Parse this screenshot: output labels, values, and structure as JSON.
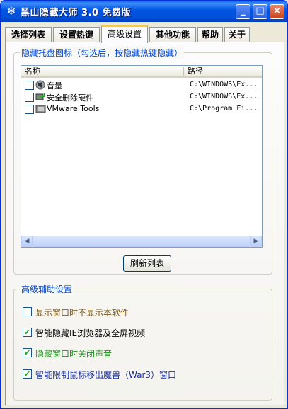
{
  "window": {
    "title": "黑山隐藏大师 3.0 免费版",
    "app_icon": "snowflake-icon",
    "controls": {
      "minimize": "_",
      "maximize": "□",
      "close": "×"
    }
  },
  "tabs": [
    {
      "label": "选择列表",
      "active": false
    },
    {
      "label": "设置热键",
      "active": false
    },
    {
      "label": "高级设置",
      "active": true
    },
    {
      "label": "其他功能",
      "active": false
    },
    {
      "label": "帮助",
      "active": false
    },
    {
      "label": "关于",
      "active": false
    }
  ],
  "tray_group": {
    "title": "隐藏托盘图标（勾选后，按隐藏热键隐藏）",
    "columns": [
      "名称",
      "路径"
    ],
    "rows": [
      {
        "name": "音量",
        "path": "C:\\WINDOWS\\Ex...",
        "icon": "speaker-icon",
        "checked": false
      },
      {
        "name": "安全删除硬件",
        "path": "C:\\WINDOWS\\Ex...",
        "icon": "safely-remove-hardware-icon",
        "checked": false
      },
      {
        "name": "VMware Tools",
        "path": "C:\\Program Fi...",
        "icon": "vmware-tools-icon",
        "checked": false
      }
    ],
    "refresh_button": "刷新列表"
  },
  "advanced_group": {
    "title": "高级辅助设置",
    "options": [
      {
        "label": "显示窗口时不显示本软件",
        "checked": false,
        "color": "#7a5c1e"
      },
      {
        "label": "智能隐藏IE浏览器及全屏视频",
        "checked": true,
        "color": "#000000"
      },
      {
        "label": "隐藏窗口时关闭声音",
        "checked": true,
        "color": "#1e8a1e"
      },
      {
        "label": "智能限制鼠标移出魔兽（War3）窗口",
        "checked": true,
        "color": "#1a2f9a"
      }
    ]
  }
}
